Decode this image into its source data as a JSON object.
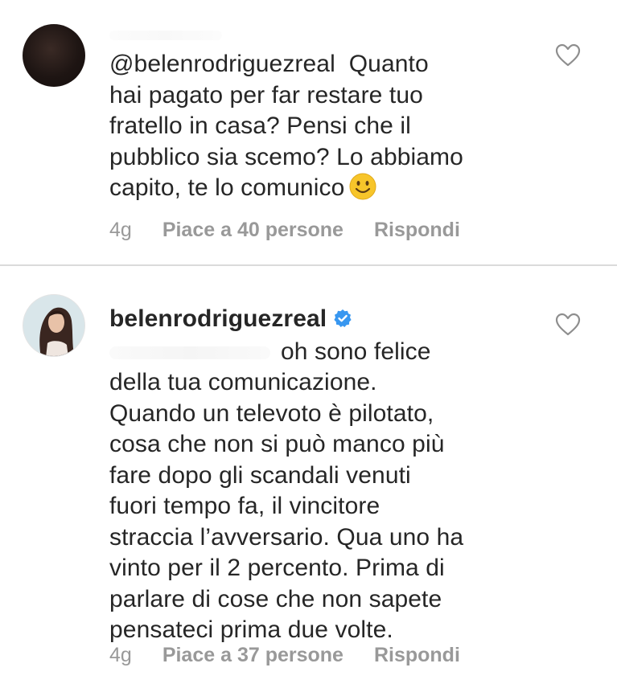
{
  "comments": [
    {
      "mention": "@belenrodriguezreal",
      "text_lines": [
        "Quanto",
        "hai pagato per far restare tuo",
        "fratello in casa? Pensi che il",
        "pubblico sia scemo? Lo abbiamo",
        "capito, te lo comunico"
      ],
      "emoji": "slightly-smiling-face-icon",
      "time": "4g",
      "likes": "Piace a 40 persone",
      "reply": "Rispondi"
    },
    {
      "username": "belenrodriguezreal",
      "verified": true,
      "text_lines": [
        "oh sono felice",
        "della tua comunicazione.",
        "Quando un televoto è pilotato,",
        "cosa che non si può manco più",
        "fare dopo gli scandali venuti",
        "fuori tempo fa, il vincitore",
        "straccia l’avversario. Qua uno ha",
        "vinto per il 2 percento. Prima di",
        "parlare di cose che non sapete",
        "pensateci prima due volte."
      ],
      "time": "4g",
      "likes": "Piace a 37 persone",
      "reply": "Rispondi"
    }
  ],
  "colors": {
    "text": "#262626",
    "meta": "#999999",
    "divider": "#dbdbdb",
    "verified": "#3897f0",
    "emoji": "#f7c52a"
  }
}
